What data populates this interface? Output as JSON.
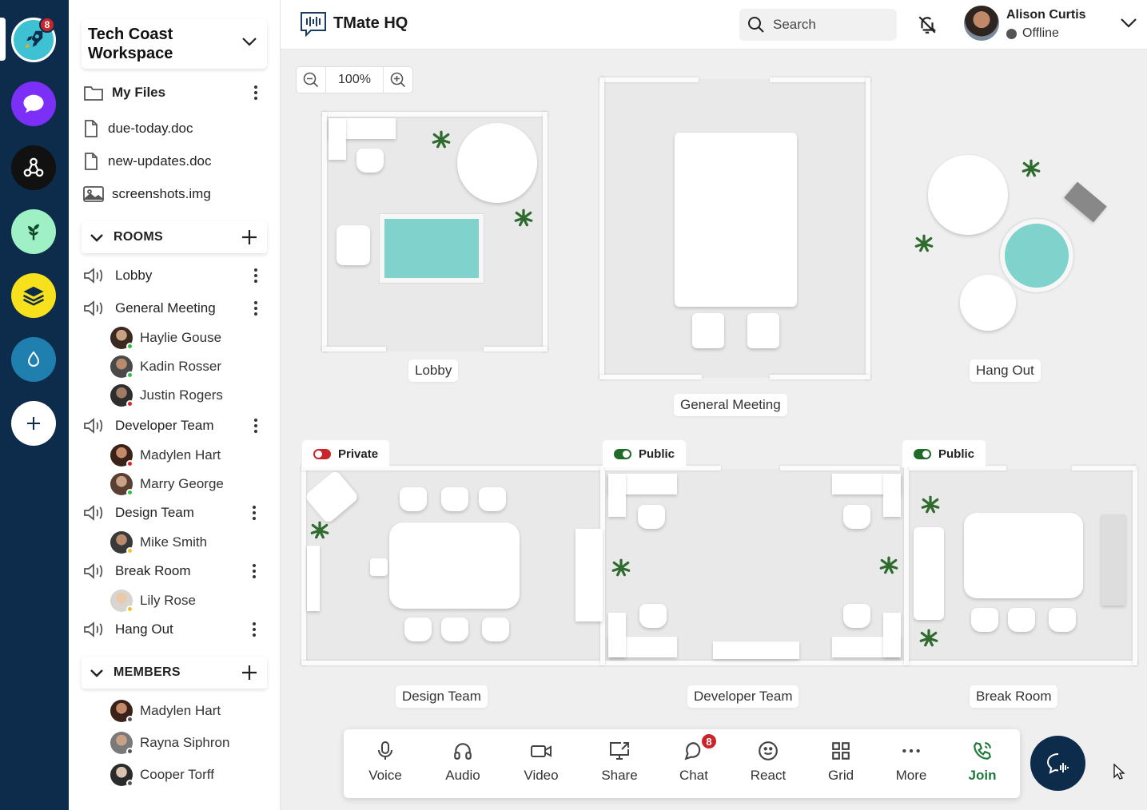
{
  "rail": {
    "apps": [
      {
        "icon": "rocket-icon",
        "color": "#3ec1d3",
        "badge": "8"
      },
      {
        "icon": "chat-bubble-icon",
        "color": "#7b2ff7"
      },
      {
        "icon": "webhook-icon",
        "color": "#111111"
      },
      {
        "icon": "plant-icon",
        "color": "#9ff0c4"
      },
      {
        "icon": "layers-icon",
        "color": "#f7e01c"
      },
      {
        "icon": "droplet-icon",
        "color": "#1f7fae"
      },
      {
        "icon": "add-icon",
        "color": "#ffffff"
      }
    ]
  },
  "workspace": {
    "name": "Tech Coast Workspace"
  },
  "files": {
    "my_files": "My Files",
    "items": [
      "due-today.doc",
      "new-updates.doc",
      "screenshots.img"
    ]
  },
  "rooms_section": {
    "label": "ROOMS"
  },
  "rooms": {
    "lobby": "Lobby",
    "general": "General Meeting",
    "general_members": [
      "Haylie Gouse",
      "Kadin Rosser",
      "Justin Rogers"
    ],
    "developer": "Developer Team",
    "developer_members": [
      "Madylen Hart",
      "Marry George"
    ],
    "design": "Design Team",
    "design_members": [
      "Mike Smith"
    ],
    "break": "Break Room",
    "break_members": [
      "Lily Rose"
    ],
    "hangout": "Hang Out"
  },
  "members_section": {
    "label": "MEMBERS"
  },
  "members": [
    "Madylen Hart",
    "Rayna Siphron",
    "Cooper Torff"
  ],
  "header": {
    "title": "TMate HQ",
    "search_placeholder": "Search",
    "user_name": "Alison Curtis",
    "user_status": "Offline"
  },
  "zoom": {
    "value": "100%"
  },
  "map": {
    "lobby": "Lobby",
    "general": "General Meeting",
    "hangout": "Hang Out",
    "design": "Design Team",
    "developer": "Developer Team",
    "break": "Break Room",
    "tag_private": "Private",
    "tag_public_1": "Public",
    "tag_public_2": "Public"
  },
  "toolbar": {
    "voice": "Voice",
    "audio": "Audio",
    "video": "Video",
    "share": "Share",
    "chat": "Chat",
    "chat_badge": "8",
    "react": "React",
    "grid": "Grid",
    "more": "More",
    "join": "Join"
  },
  "colors": {
    "rail_bg": "#0d2b4a",
    "badge": "#c8262b",
    "private_toggle": "#c8262b",
    "public_toggle": "#1f6b2a",
    "join": "#1f7a3a",
    "pool": "#7fd3cc"
  }
}
